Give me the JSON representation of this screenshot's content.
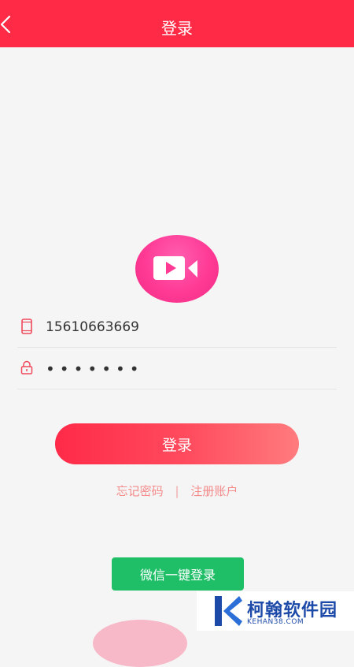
{
  "header": {
    "title": "登录",
    "background_color": "#ff2b46",
    "back_icon": "chevron-left-icon"
  },
  "logo": {
    "icon": "video-camera-icon",
    "color": "#ff3a95"
  },
  "form": {
    "phone": {
      "icon": "phone-icon",
      "value": "15610663669"
    },
    "password": {
      "icon": "lock-icon",
      "value": "•••••••"
    }
  },
  "login_button": {
    "label": "登录"
  },
  "links": {
    "forgot_password": "忘记密码",
    "separator": "|",
    "register": "注册账户"
  },
  "wechat_button": {
    "label": "微信一键登录",
    "color": "#1fbf68"
  },
  "watermark": {
    "name": "柯翰软件园",
    "domain": "KEHAN38.COM"
  }
}
